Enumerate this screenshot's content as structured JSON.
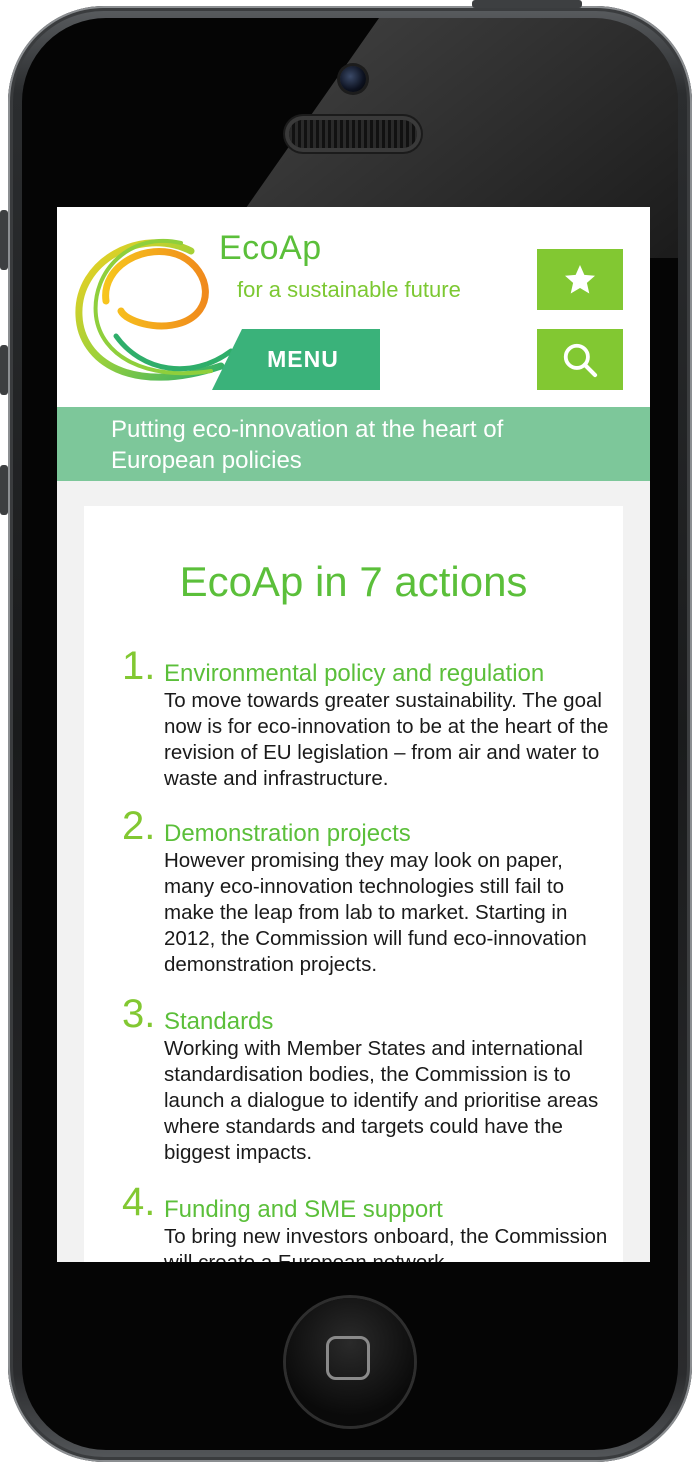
{
  "header": {
    "brand": "EcoAp",
    "tagline_small": "for a sustainable future",
    "menu_label": "MENU",
    "favorite_icon": "star-icon",
    "search_icon": "search-icon"
  },
  "banner": {
    "text": "Putting eco-innovation at the heart of European policies"
  },
  "content": {
    "title": "EcoAp in 7 actions",
    "actions": [
      {
        "number": "1.",
        "title": "Environmental policy and regulation",
        "body": "To move towards greater sustainability. The goal now is for eco-innovation to be at the heart of the revision of EU legislation – from air and water to waste and infrastructure."
      },
      {
        "number": "2.",
        "title": "Demonstration projects",
        "body": "However promising they may look on paper, many eco-innovation technologies still fail to make the leap from lab to market. Starting in 2012, the Commission will fund eco-innovation demonstration projects."
      },
      {
        "number": "3.",
        "title": "Standards",
        "body": "Working with Member States and international standardisation bodies, the Commission is to launch a dialogue to identify and prioritise areas where standards and targets could have the biggest impacts."
      },
      {
        "number": "4.",
        "title": "Funding and SME support",
        "body": "To bring new investors onboard, the Commission will create a European network"
      }
    ]
  },
  "colors": {
    "brand_green": "#5bbf3a",
    "lime": "#82c832",
    "menu_green": "#3ab27a",
    "banner_green": "#7dc79a"
  }
}
